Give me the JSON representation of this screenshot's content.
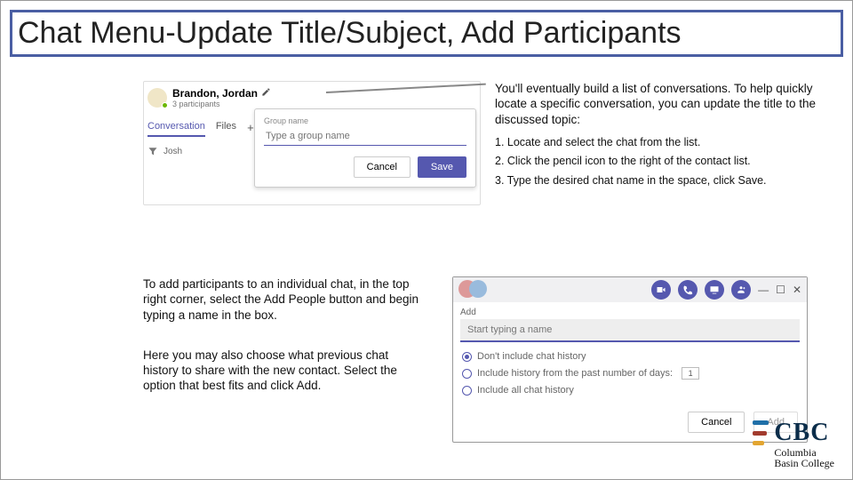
{
  "title": "Chat Menu-Update Title/Subject, Add Participants",
  "intro_para": "You'll eventually build a list of conversations.  To help quickly locate a specific conversation, you can update the title to the discussed topic:",
  "step1": "1. Locate and select the chat from the list.",
  "step2": "2. Click the pencil icon to the right of the contact list.",
  "step3": "3. Type the desired chat name in the space, click Save.",
  "add_para1": "To add participants to an individual chat, in the top right corner, select the Add People button and begin typing a name in the box.",
  "add_para2": "Here you may also choose what previous chat history to share with the new contact.  Select the option that best fits and click Add.",
  "shot1": {
    "chat_title": "Brandon, Jordan",
    "participants": "3 participants",
    "tab_conversation": "Conversation",
    "tab_files": "Files",
    "filter_name": "Josh",
    "popup_label": "Group name",
    "popup_placeholder": "Type a group name",
    "cancel": "Cancel",
    "save": "Save"
  },
  "shot2": {
    "add_label": "Add",
    "typing_placeholder": "Start typing a name",
    "opt1": "Don't include chat history",
    "opt2": "Include history from the past number of days:",
    "opt2_days": "1",
    "opt3": "Include all chat history",
    "cancel": "Cancel",
    "add": "Add"
  },
  "logo": {
    "abbr": "CBC",
    "line1": "Columbia",
    "line2": "Basin College"
  }
}
